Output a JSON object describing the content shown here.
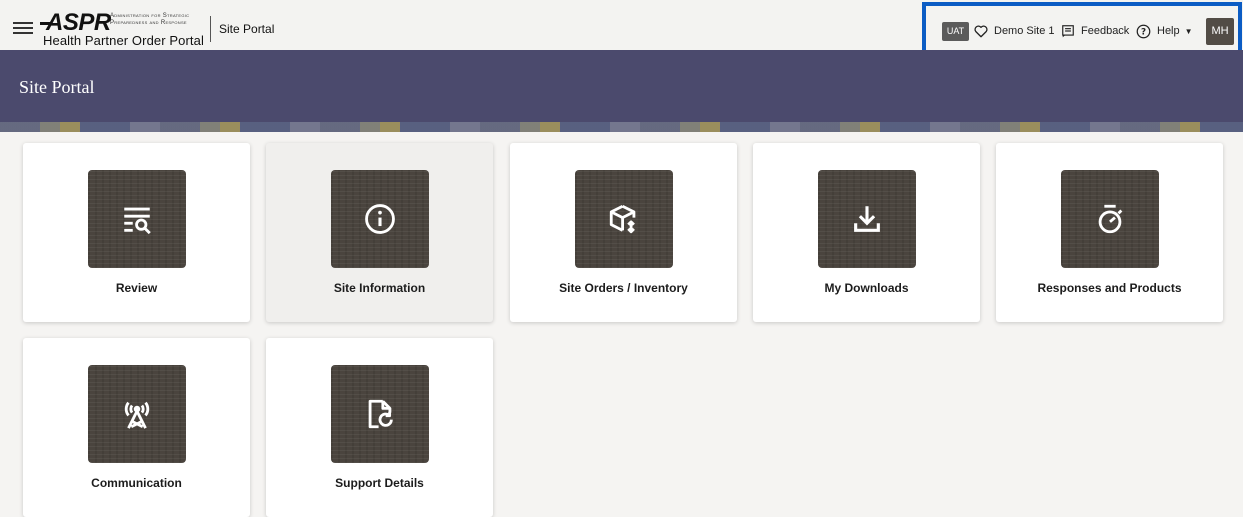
{
  "header": {
    "logo_main": "ASPR",
    "logo_tagline": "Administration for Strategic Preparedness and Response",
    "logo_subtitle": "Health Partner Order Portal",
    "app_name": "Site Portal",
    "env_badge": "UAT",
    "site_name": "Demo Site 1",
    "feedback_label": "Feedback",
    "help_label": "Help",
    "avatar_initials": "MH",
    "highlight_color": "#0b5cc4"
  },
  "banner": {
    "title": "Site Portal",
    "color": "#4b4a6d"
  },
  "cards": [
    {
      "label": "Review",
      "icon": "review-list-search-icon"
    },
    {
      "label": "Site Information",
      "icon": "info-icon"
    },
    {
      "label": "Site Orders / Inventory",
      "icon": "box-inventory-icon"
    },
    {
      "label": "My Downloads",
      "icon": "download-icon"
    },
    {
      "label": "Responses and Products",
      "icon": "timer-icon"
    },
    {
      "label": "Communication",
      "icon": "broadcast-tower-icon"
    },
    {
      "label": "Support Details",
      "icon": "document-refresh-icon"
    }
  ]
}
